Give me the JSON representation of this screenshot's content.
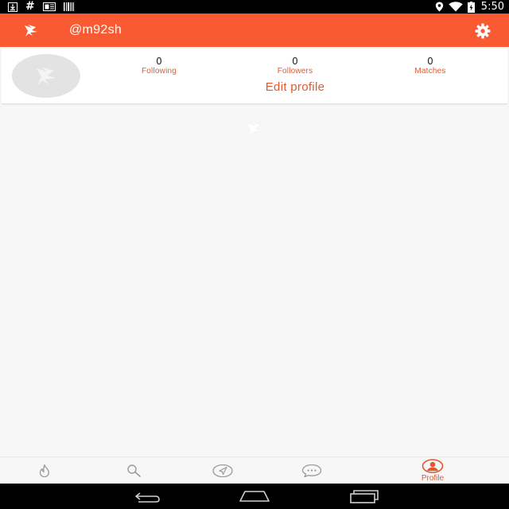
{
  "status_bar": {
    "time": "5:50",
    "left_icons": [
      "download-icon",
      "hash-icon",
      "news-icon",
      "barcode-icon"
    ],
    "hash_glyph": "#",
    "right_icons": [
      "location-icon",
      "wifi-icon",
      "battery-icon"
    ]
  },
  "app_bar": {
    "logo_icon": "bird-logo-icon",
    "username": "@m92sh",
    "settings_icon": "gear-icon",
    "background_color": "#fa5a32"
  },
  "profile": {
    "avatar_icon": "bird-placeholder-icon",
    "stats": [
      {
        "count": "0",
        "label": "Following"
      },
      {
        "count": "0",
        "label": "Followers"
      },
      {
        "count": "0",
        "label": "Matches"
      }
    ],
    "edit_profile_label": "Edit profile"
  },
  "bottom_nav": {
    "items": [
      {
        "icon": "flame-icon",
        "label": ""
      },
      {
        "icon": "search-icon",
        "label": ""
      },
      {
        "icon": "compass-icon",
        "label": ""
      },
      {
        "icon": "chat-icon",
        "label": ""
      },
      {
        "icon": "profile-icon",
        "label": "Profile",
        "active": true
      }
    ],
    "accent_color": "#e4582f"
  },
  "system_nav": {
    "buttons": [
      "back-icon",
      "home-icon",
      "recents-icon"
    ]
  }
}
